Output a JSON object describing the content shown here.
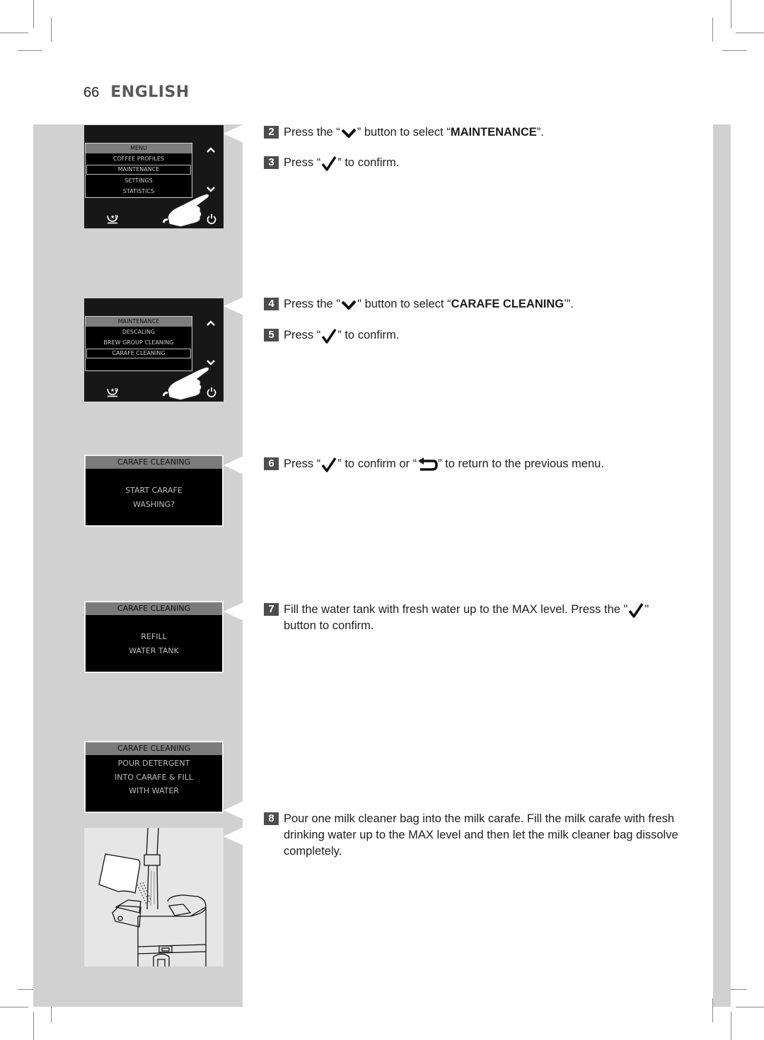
{
  "header": {
    "page_number": "66",
    "language": "ENGLISH"
  },
  "panels": [
    {
      "type": "device",
      "menu_title": "MENU",
      "items": [
        "COFFEE PROFILES",
        "MAINTENANCE",
        "SETTINGS",
        "STATISTICS"
      ],
      "selected_index": 1,
      "icons": [
        "chevron-up-icon",
        "chevron-down-icon",
        "coffee-profile-icon",
        "power-icon",
        "pointing-hand-icon"
      ]
    },
    {
      "type": "device",
      "menu_title": "MAINTENANCE",
      "items": [
        "DESCALING",
        "BREW GROUP CLEANING",
        "CARAFE CLEANING",
        ""
      ],
      "selected_index": 2,
      "icons": [
        "chevron-up-icon",
        "chevron-down-icon",
        "coffee-profile-icon",
        "power-icon",
        "pointing-hand-icon"
      ]
    },
    {
      "type": "screen",
      "title": "CARAFE CLEANING",
      "lines": [
        "START CARAFE",
        "WASHING?"
      ]
    },
    {
      "type": "screen",
      "title": "CARAFE CLEANING",
      "lines": [
        "REFILL",
        "WATER TANK"
      ]
    },
    {
      "type": "screen",
      "title": "CARAFE CLEANING",
      "lines": [
        "POUR DETERGENT",
        "INTO CARAFE & FILL",
        "WITH WATER"
      ]
    },
    {
      "type": "illustration",
      "subject": "milk-cleaner-bag-poured-into-carafe-icon"
    }
  ],
  "steps": [
    {
      "number": "2",
      "pre": "Press the “",
      "icon": "chevron-down-icon",
      "post": "” button to select “",
      "bold": "MAINTENANCE",
      "end": "”."
    },
    {
      "number": "3",
      "pre": "Press “",
      "icon": "check-icon",
      "post": "” to confirm."
    },
    {
      "number": "4",
      "pre": "Press the \"",
      "icon": "chevron-down-icon",
      "post": "\" button to select “",
      "bold": "CARAFE CLEANING",
      "end": "’”."
    },
    {
      "number": "5",
      "pre": "Press “",
      "icon": "check-icon",
      "post": "” to confirm."
    },
    {
      "number": "6",
      "pre": "Press “",
      "icon": "check-icon",
      "mid": "” to confirm or “",
      "icon2": "back-arrow-icon",
      "post": "” to return to the previous menu."
    },
    {
      "number": "7",
      "pre": "Fill the water tank with fresh water up to the MAX level. Press the \"",
      "icon": "check-icon",
      "post": "\" button to confirm."
    },
    {
      "number": "8",
      "text": "Pour one milk cleaner bag into the milk carafe. Fill the milk carafe with fresh drinking water up to the MAX level and then let the milk cleaner bag dissolve completely."
    }
  ]
}
